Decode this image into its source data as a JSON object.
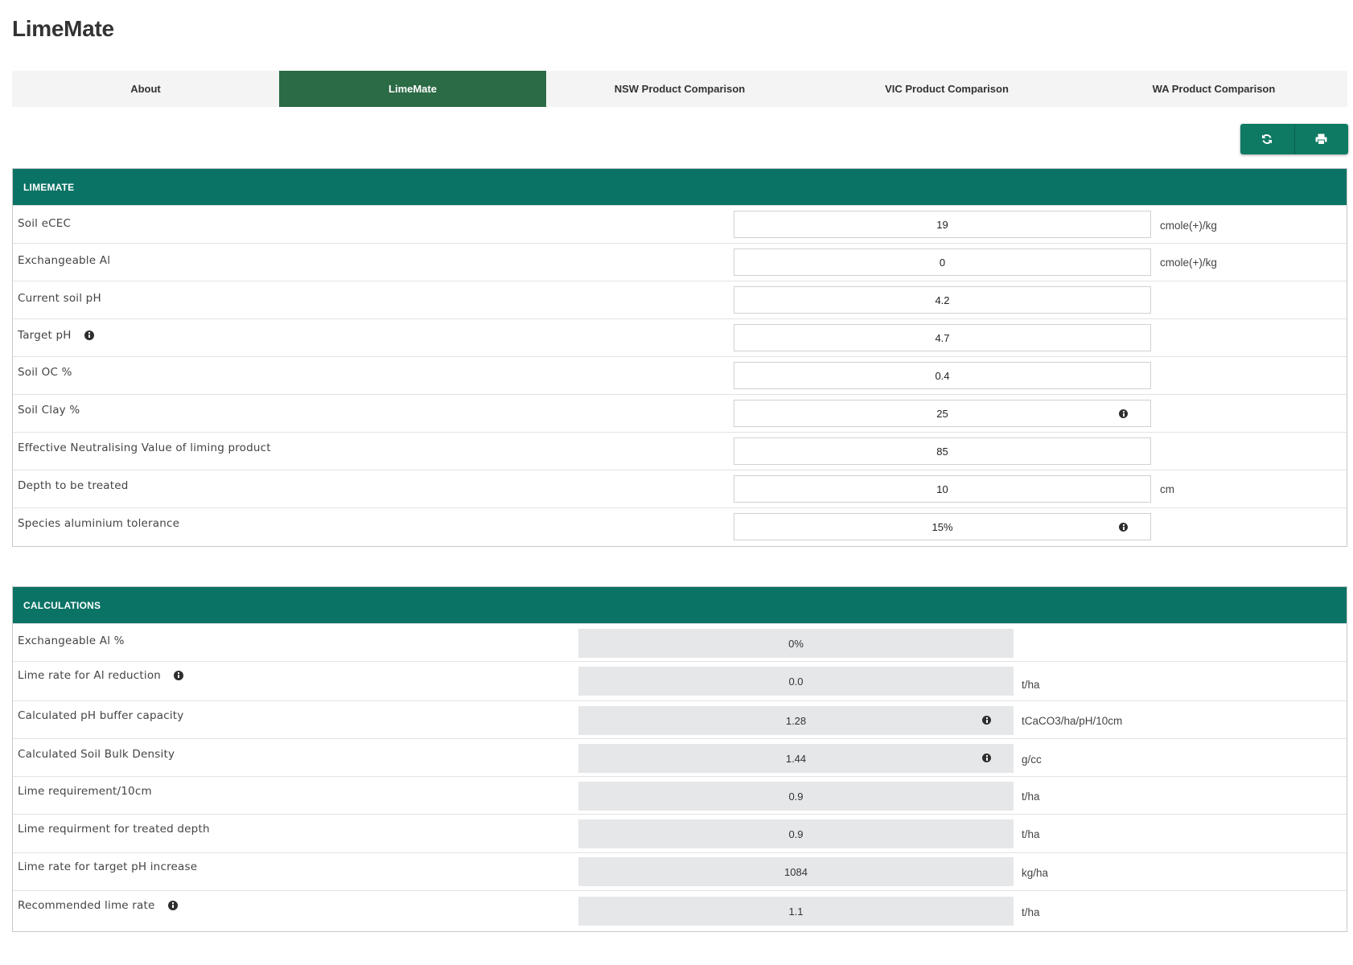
{
  "app": {
    "title": "LimeMate"
  },
  "tabs": [
    {
      "label": "About",
      "active": false
    },
    {
      "label": "LimeMate",
      "active": true
    },
    {
      "label": "NSW Product Comparison",
      "active": false
    },
    {
      "label": "VIC Product Comparison",
      "active": false
    },
    {
      "label": "WA Product Comparison",
      "active": false
    }
  ],
  "toolbar": {
    "buttons": [
      {
        "icon": "refresh-icon"
      },
      {
        "icon": "print-icon"
      }
    ]
  },
  "limemate": {
    "header": "LIMEMATE",
    "rows": [
      {
        "label": "Soil eCEC",
        "value": "19",
        "unit": "cmole(+)/kg"
      },
      {
        "label": "Exchangeable Al",
        "value": "0",
        "unit": "cmole(+)/kg"
      },
      {
        "label": "Current soil pH",
        "value": "4.2",
        "unit": ""
      },
      {
        "label": "Target pH",
        "value": "4.7",
        "unit": ""
      },
      {
        "label": "Soil OC %",
        "value": "0.4",
        "unit": ""
      },
      {
        "label": "Soil Clay %",
        "value": "25",
        "unit": ""
      },
      {
        "label": "Effective Neutralising Value of liming product",
        "value": "85",
        "unit": ""
      },
      {
        "label": "Depth to be treated",
        "value": "10",
        "unit": "cm"
      },
      {
        "label": "Species aluminium tolerance",
        "value": "15%",
        "unit": ""
      }
    ]
  },
  "calculations": {
    "header": "CALCULATIONS",
    "rows": [
      {
        "label": "Exchangeable Al %",
        "value": "0%",
        "unit": ""
      },
      {
        "label": "Lime rate for Al reduction",
        "value": "0.0",
        "unit": "t/ha"
      },
      {
        "label": "Calculated pH buffer capacity",
        "value": "1.28",
        "unit": "tCaCO3/ha/pH/10cm"
      },
      {
        "label": "Calculated Soil Bulk Density",
        "value": "1.44",
        "unit": "g/cc"
      },
      {
        "label": "Lime requirement/10cm",
        "value": "0.9",
        "unit": "t/ha"
      },
      {
        "label": "Lime requirment for treated depth",
        "value": "0.9",
        "unit": "t/ha"
      },
      {
        "label": "Lime rate for target pH increase",
        "value": "1084",
        "unit": "kg/ha"
      },
      {
        "label": "Recommended lime rate",
        "value": "1.1",
        "unit": "t/ha"
      }
    ]
  },
  "colors": {
    "tab_active": "#2b6b45",
    "panel_header": "#0b7366",
    "button": "#0f7a63",
    "calc_field": "#e6e7e9"
  }
}
